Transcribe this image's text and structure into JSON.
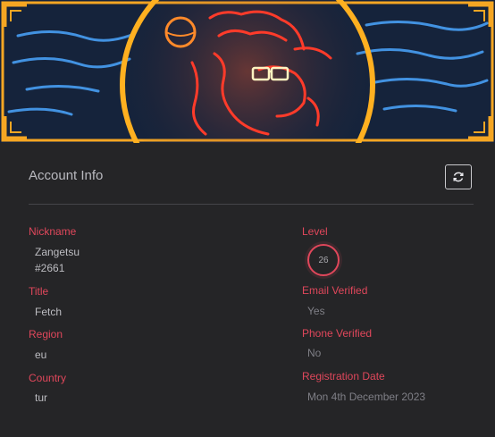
{
  "card": {
    "title": "Account Info",
    "refresh_icon": "refresh-icon"
  },
  "banner": {
    "image_icon": "neon-dragon-banner"
  },
  "fields": {
    "nickname_label": "Nickname",
    "nickname_line1": "Zangetsu",
    "nickname_line2": "#2661",
    "title_label": "Title",
    "title_value": "Fetch",
    "region_label": "Region",
    "region_value": "eu",
    "country_label": "Country",
    "country_value": "tur",
    "level_label": "Level",
    "level_value": "26",
    "email_label": "Email Verified",
    "email_value": "Yes",
    "phone_label": "Phone Verified",
    "phone_value": "No",
    "reg_label": "Registration Date",
    "reg_value": "Mon 4th December 2023"
  },
  "colors": {
    "accent": "#e0475b",
    "banner_border": "#f5a623",
    "panel_bg": "#252527"
  }
}
